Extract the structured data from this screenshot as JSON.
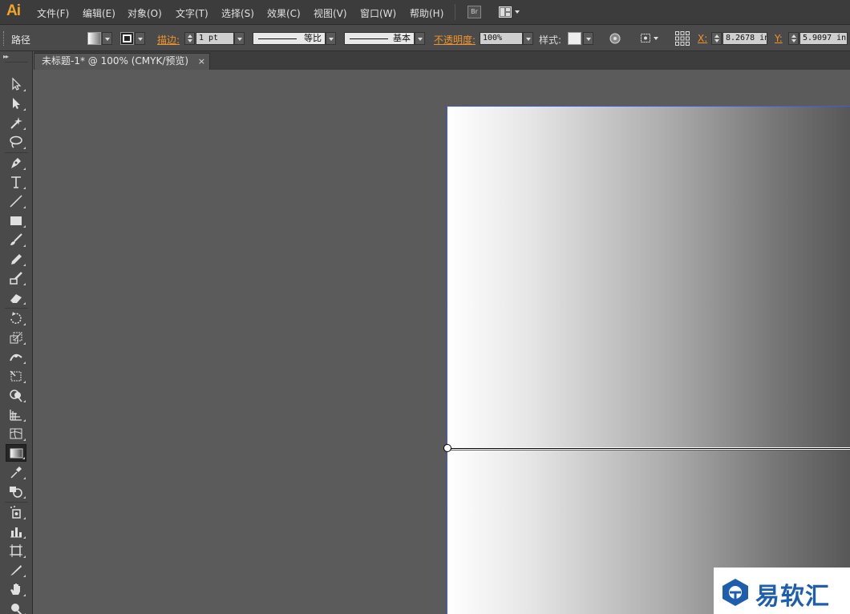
{
  "app": {
    "logo": "Ai",
    "accent_color": "#f0a52a",
    "menu": [
      {
        "id": "file",
        "label": "文件(F)"
      },
      {
        "id": "edit",
        "label": "编辑(E)"
      },
      {
        "id": "object",
        "label": "对象(O)"
      },
      {
        "id": "type",
        "label": "文字(T)"
      },
      {
        "id": "select",
        "label": "选择(S)"
      },
      {
        "id": "effect",
        "label": "效果(C)"
      },
      {
        "id": "view",
        "label": "视图(V)"
      },
      {
        "id": "window",
        "label": "窗口(W)"
      },
      {
        "id": "help",
        "label": "帮助(H)"
      }
    ],
    "bridge_button": "Br"
  },
  "control_bar": {
    "selection_type": "路径",
    "stroke_label": "描边:",
    "stroke_weight": "1 pt",
    "stroke_profile_variable": "等比",
    "stroke_profile_brush": "基本",
    "opacity_label": "不透明度:",
    "opacity_value": "100%",
    "style_label": "样式:",
    "x_label": "X:",
    "x_value": "8.2678 in",
    "y_label": "Y:",
    "y_value": "5.9097 in"
  },
  "document": {
    "tab_title": "未标题-1* @ 100% (CMYK/预览)",
    "tab_close": "×"
  },
  "toolbox": {
    "collapse": "▸▸",
    "tools": [
      {
        "name": "selection-tool-icon"
      },
      {
        "name": "direct-selection-tool-icon"
      },
      {
        "name": "magic-wand-tool-icon"
      },
      {
        "name": "lasso-tool-icon"
      },
      {
        "name": "pen-tool-icon"
      },
      {
        "name": "type-tool-icon"
      },
      {
        "name": "line-segment-tool-icon"
      },
      {
        "name": "rectangle-tool-icon"
      },
      {
        "name": "paintbrush-tool-icon"
      },
      {
        "name": "pencil-tool-icon"
      },
      {
        "name": "blob-brush-tool-icon"
      },
      {
        "name": "eraser-tool-icon"
      },
      {
        "name": "rotate-tool-icon"
      },
      {
        "name": "scale-tool-icon"
      },
      {
        "name": "width-tool-icon"
      },
      {
        "name": "free-transform-tool-icon"
      },
      {
        "name": "shape-builder-tool-icon"
      },
      {
        "name": "perspective-grid-tool-icon"
      },
      {
        "name": "mesh-tool-icon"
      },
      {
        "name": "gradient-tool-icon",
        "active": true
      },
      {
        "name": "eyedropper-tool-icon"
      },
      {
        "name": "blend-tool-icon"
      },
      {
        "name": "symbol-sprayer-tool-icon"
      },
      {
        "name": "column-graph-tool-icon"
      },
      {
        "name": "artboard-tool-icon"
      },
      {
        "name": "slice-tool-icon"
      },
      {
        "name": "hand-tool-icon"
      },
      {
        "name": "zoom-tool-icon"
      }
    ]
  },
  "watermark": {
    "text": "易软汇",
    "color": "#1d5fae"
  }
}
